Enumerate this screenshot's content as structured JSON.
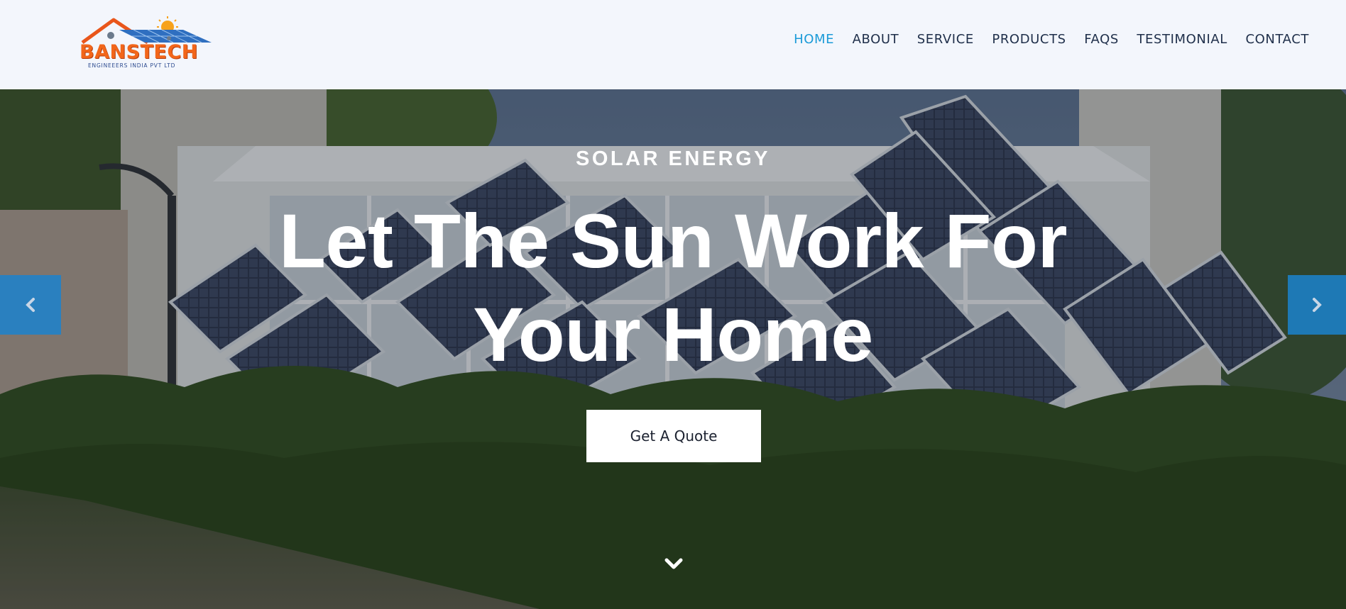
{
  "brand": {
    "name": "BANSTECH",
    "tagline": "ENGINEEERS INDIA PVT LTD"
  },
  "nav": {
    "items": [
      {
        "label": "HOME",
        "active": true
      },
      {
        "label": "ABOUT",
        "active": false
      },
      {
        "label": "SERVICE",
        "active": false
      },
      {
        "label": "PRODUCTS",
        "active": false
      },
      {
        "label": "FAQS",
        "active": false
      },
      {
        "label": "TESTIMONIAL",
        "active": false
      },
      {
        "label": "CONTACT",
        "active": false
      }
    ]
  },
  "hero": {
    "kicker": "SOLAR ENERGY",
    "headline_line1": "Let The Sun Work For",
    "headline_line2": "Your Home",
    "cta_label": "Get A Quote"
  },
  "icons": {
    "prev": "chevron-left-icon",
    "next": "chevron-right-icon",
    "scroll": "chevron-down-icon"
  },
  "colors": {
    "nav_bg": "#f3f6fc",
    "nav_text": "#1f2f4a",
    "nav_active": "#1b9bd8",
    "arrow_bg": "#1b82ce",
    "brand_orange": "#f2661a"
  }
}
